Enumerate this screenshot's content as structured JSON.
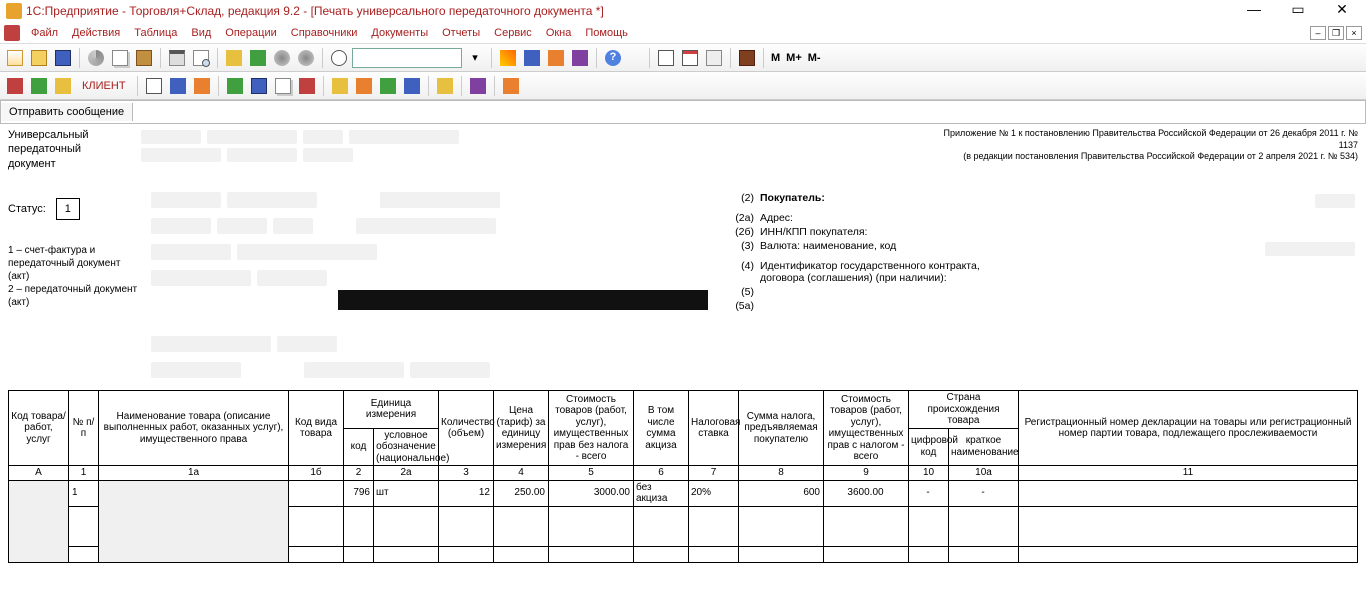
{
  "window": {
    "title": "1С:Предприятие - Торговля+Склад, редакция 9.2 - [Печать универсального передаточного документа *]"
  },
  "menu": {
    "items": [
      "Файл",
      "Действия",
      "Таблица",
      "Вид",
      "Операции",
      "Справочники",
      "Документы",
      "Отчеты",
      "Сервис",
      "Окна",
      "Помощь"
    ]
  },
  "toolbar2": {
    "client_label": "КЛИЕНТ",
    "m": "М",
    "mplus": "М+",
    "mminus": "М-"
  },
  "msgbar": {
    "send": "Отправить сообщение"
  },
  "doc": {
    "title": "Универсальный передаточный документ",
    "appendix_line1": "Приложение № 1 к постановлению Правительства Российской Федерации от 26 декабря 2011 г. № 1137",
    "appendix_line2": "(в редакции постановления Правительства Российской Федерации от 2 апреля 2021 г. № 534)",
    "status_label": "Статус:",
    "status_value": "1",
    "legal1": "1 – счет-фактура и передаточный документ (акт)",
    "legal2": "2 – передаточный документ (акт)",
    "fields": [
      {
        "num": "(2)",
        "label": "Покупатель:",
        "bold": true
      },
      {
        "num": "(2а)",
        "label": "Адрес:"
      },
      {
        "num": "(2б)",
        "label": "ИНН/КПП покупателя:"
      },
      {
        "num": "(3)",
        "label": "Валюта: наименование, код"
      },
      {
        "num": "(4)",
        "label": "Идентификатор государственного контракта, договора (соглашения) (при наличии):"
      },
      {
        "num": "(5)",
        "label": ""
      },
      {
        "num": "(5а)",
        "label": ""
      }
    ]
  },
  "table": {
    "headers": {
      "c1": "Код товара/ работ, услуг",
      "c2": "№ п/п",
      "c3": "Наименование товара (описание выполненных работ, оказанных услуг), имущественного права",
      "c4": "Код вида товара",
      "c5group": "Единица измерения",
      "c5a": "код",
      "c5b": "условное обозначение (национальное)",
      "c6": "Количество (объем)",
      "c7": "Цена (тариф) за единицу измерения",
      "c8": "Стоимость товаров (работ, услуг), имущественных прав без налога - всего",
      "c9": "В том числе сумма акциза",
      "c10": "Налоговая ставка",
      "c11": "Сумма налога, предъявляемая покупателю",
      "c12": "Стоимость товаров (работ, услуг), имущественных прав с налогом - всего",
      "c13group": "Страна происхождения товара",
      "c13a": "цифровой код",
      "c13b": "краткое наименование",
      "c14": "Регистрационный номер декларации на товары или регистрационный номер партии товара, подлежащего прослеживаемости"
    },
    "colnums": [
      "А",
      "1",
      "1а",
      "1б",
      "2",
      "2а",
      "3",
      "4",
      "5",
      "6",
      "7",
      "8",
      "9",
      "10",
      "10а",
      "11"
    ],
    "row1": {
      "num": "1",
      "unit_code": "796",
      "unit_name": "шт",
      "qty": "12",
      "price": "250.00",
      "sum_no_tax": "3000.00",
      "excise": "без акциза",
      "rate": "20%",
      "tax": "600",
      "sum_with_tax": "3600.00",
      "country_code": "-",
      "country_name": "-"
    }
  }
}
